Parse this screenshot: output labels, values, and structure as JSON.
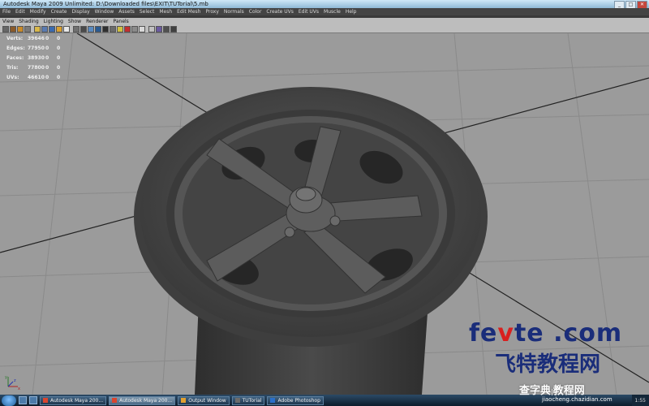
{
  "window": {
    "title": "Autodesk Maya 2009 Unlimited: D:\\Downloaded files\\EXIT\\TUTorial\\5.mb",
    "controls": [
      "_",
      "□",
      "✕"
    ]
  },
  "menubar": [
    "File",
    "Edit",
    "Modify",
    "Create",
    "Display",
    "Window",
    "Assets",
    "Select",
    "Mesh",
    "Edit Mesh",
    "Proxy",
    "Normals",
    "Color",
    "Create UVs",
    "Edit UVs",
    "Muscle",
    "Help"
  ],
  "panel_menu": [
    "View",
    "Shading",
    "Lighting",
    "Show",
    "Renderer",
    "Panels"
  ],
  "hud": [
    {
      "label": "Verts:",
      "value": "39646",
      "a": "0",
      "b": "0"
    },
    {
      "label": "Edges:",
      "value": "77950",
      "a": "0",
      "b": "0"
    },
    {
      "label": "Faces:",
      "value": "38930",
      "a": "0",
      "b": "0"
    },
    {
      "label": "Tris:",
      "value": "77800",
      "a": "0",
      "b": "0"
    },
    {
      "label": "UVs:",
      "value": "46610",
      "a": "0",
      "b": "0"
    }
  ],
  "axis": {
    "x": "x",
    "y": "y",
    "z": "z"
  },
  "watermark": {
    "en_a": "fe",
    "en_b": "v",
    "en_c": "te .com",
    "cn": "飞特教程网"
  },
  "taskbar": {
    "tasks": [
      {
        "label": "Autodesk Maya 200..."
      },
      {
        "label": "Autodesk Maya 200..."
      },
      {
        "label": "Output Window"
      },
      {
        "label": "TUTorial"
      },
      {
        "label": "Adobe Photoshop"
      }
    ],
    "clock": "1:55"
  },
  "watermark2": {
    "cn": "查字典",
    "cn2": "教程网",
    "url": "jiaocheng.chazidian.com"
  },
  "colors": {
    "viewport": "#9b9b9b",
    "wheel": "#4a4a4a",
    "menubar": "#444444",
    "watermark_blue": "#1a2d7a",
    "watermark_red": "#d9201f"
  }
}
